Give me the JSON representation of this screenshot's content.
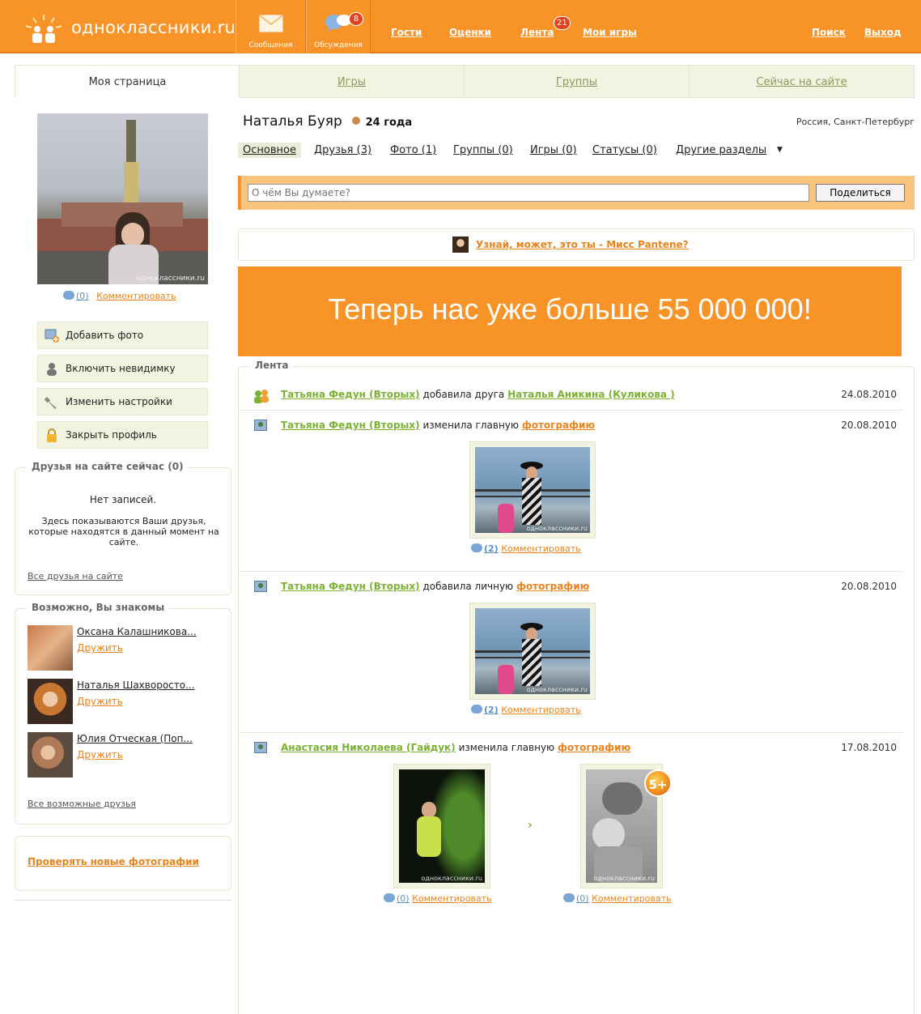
{
  "site": {
    "logo_text": "одноклассники.ru"
  },
  "topbar": {
    "messages_label": "Сообщения",
    "discussions_label": "Обсуждения",
    "discussions_badge": "8",
    "guests": "Гости",
    "ratings": "Оценки",
    "feed": "Лента",
    "feed_badge": "21",
    "my_games": "Мои игры",
    "search": "Поиск",
    "logout": "Выход"
  },
  "tabs": [
    "Моя страница",
    "Игры",
    "Группы",
    "Сейчас на сайте"
  ],
  "profile": {
    "name": "Наталья Буяр",
    "age": "24 года",
    "location": "Россия, Санкт-Петербург",
    "photo_comment_count": "(0)",
    "photo_comment_link": "Комментировать",
    "photo_watermark": "одноклассники.ru"
  },
  "subnav": [
    "Основное",
    "Друзья (3)",
    "Фото (1)",
    "Группы (0)",
    "Игры (0)",
    "Статусы (0)",
    "Другие разделы"
  ],
  "status": {
    "placeholder": "О чём Вы думаете?",
    "share_button": "Поделиться"
  },
  "promo": {
    "link": "Узнай, может, это ты - Мисс Pantene?"
  },
  "banner": {
    "text": "Теперь нас уже больше 55 000 000!",
    "color": "#f79327"
  },
  "left_actions": [
    "Добавить фото",
    "Включить невидимку",
    "Изменить настройки",
    "Закрыть профиль"
  ],
  "friends_online": {
    "title": "Друзья на сайте сейчас (0)",
    "empty": "Нет записей.",
    "description": "Здесь показываются Ваши друзья, которые находятся в данный момент на сайте.",
    "all_link": "Все друзья на сайте"
  },
  "maybe_known": {
    "title": "Возможно, Вы знакомы",
    "people": [
      {
        "name": "Оксана Калашникова...",
        "action": "Дружить"
      },
      {
        "name": "Наталья Шахворосто...",
        "action": "Дружить"
      },
      {
        "name": "Юлия Отческая (Поп...",
        "action": "Дружить"
      }
    ],
    "all_link": "Все возможные друзья"
  },
  "check_photos": {
    "link": "Проверять новые фотографии"
  },
  "feed": {
    "title": "Лента",
    "items": [
      {
        "user": "Татьяна Федун (Вторых)",
        "action": "добавила друга",
        "target": "Наталья Аникина (Куликова )",
        "date": "24.08.2010"
      },
      {
        "user": "Татьяна Федун (Вторых)",
        "action": "изменила главную",
        "target": "фотографию",
        "date": "20.08.2010",
        "comments": "(2)",
        "comment_link": "Комментировать"
      },
      {
        "user": "Татьяна Федун (Вторых)",
        "action": "добавила личную",
        "target": "фотографию",
        "date": "20.08.2010",
        "comments": "(2)",
        "comment_link": "Комментировать"
      },
      {
        "user": "Анастасия Николаева (Гайдук)",
        "action": "изменила главную",
        "target": "фотографию",
        "date": "17.08.2010",
        "comments_old": "(0)",
        "comments_new": "(0)",
        "comment_link": "Комментировать",
        "rating_badge": "5+"
      }
    ]
  },
  "colors": {
    "orange": "#f79327",
    "green": "#7cb234",
    "panel": "#f2f4e1"
  }
}
